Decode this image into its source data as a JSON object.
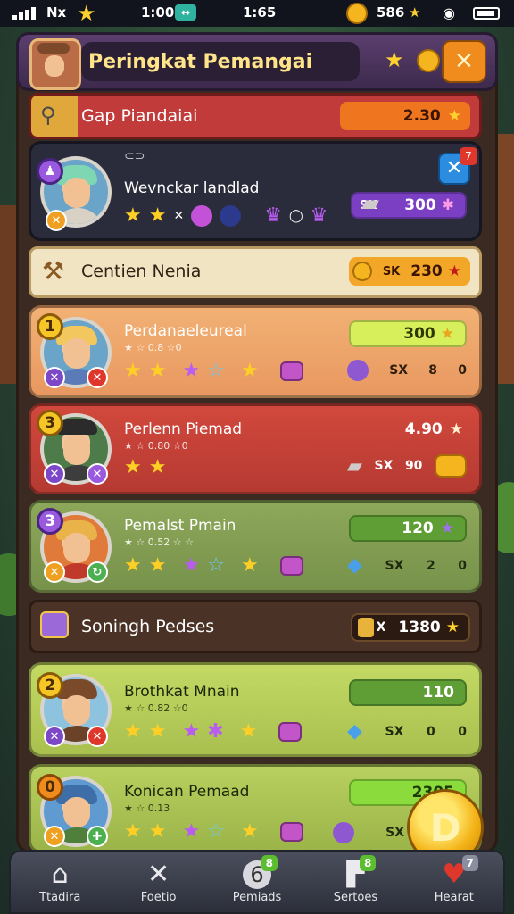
{
  "status": {
    "carrier": "Nx",
    "time_left": "1:00",
    "time_center": "1:65",
    "coins": "586"
  },
  "header": {
    "title": "Peringkat Pemangai"
  },
  "group_header": {
    "title": "Gap Piandaiai",
    "value": "2.30"
  },
  "featured": {
    "name": "Wevnckar landlad",
    "stat_label": "SK",
    "stat_value": "300"
  },
  "section1": {
    "title": "Centien Nenia",
    "stat_label": "SK",
    "value": "230"
  },
  "players": [
    {
      "rank": "1",
      "name": "Perdanaeleureal",
      "sub": "★ ☆ 0.8 ☆0",
      "score": "300",
      "stat_label": "SX",
      "stat_a": "8",
      "stat_b": "0"
    },
    {
      "rank": "3",
      "name": "Perlenn Piemad",
      "sub": "★ ☆ 0.80 ☆0",
      "score": "4.90",
      "stat_label": "SX",
      "stat_a": "90"
    },
    {
      "rank": "3",
      "name": "Pemalst Pmain",
      "sub": "★ ☆ 0.52 ☆ ☆",
      "score": "120",
      "stat_label": "SX",
      "stat_a": "2",
      "stat_b": "0"
    }
  ],
  "section2": {
    "title": "Soningh Pedses",
    "stat_label": "X",
    "value": "1380"
  },
  "players2": [
    {
      "rank": "2",
      "name": "Brothkat Mnain",
      "sub": "★ ☆ 0.82 ☆0",
      "score": "110",
      "stat_label": "SX",
      "stat_a": "0",
      "stat_b": "0"
    },
    {
      "rank": "0",
      "name": "Konican Pemaad",
      "sub": "★ ☆ 0.13",
      "score": "2305",
      "stat_label": "SX"
    }
  ],
  "nav": [
    {
      "label": "Ttadira",
      "icon": "home-icon"
    },
    {
      "label": "Foetio",
      "icon": "cross-icon"
    },
    {
      "label": "Pemiads",
      "icon": "number-badge-icon",
      "badge": "8"
    },
    {
      "label": "Sertoes",
      "icon": "sign-icon",
      "badge": "8"
    },
    {
      "label": "Hearat",
      "icon": "heart-icon",
      "badge": "7"
    }
  ],
  "colors": {
    "gold": "#ffcf25",
    "purple_header": "#5b3f6e",
    "red_header": "#c23b3b",
    "green_bar": "#8cdb3c"
  }
}
